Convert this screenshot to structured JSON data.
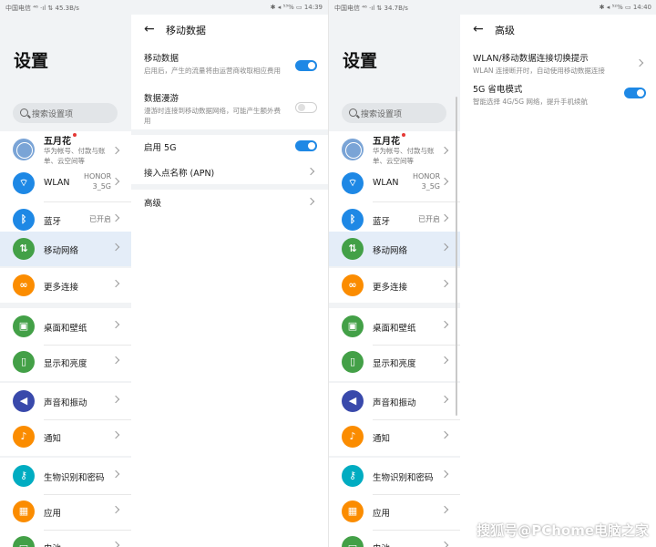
{
  "left_screen": {
    "status": {
      "left": "中国电信 ⁴⁶ ·ıl ⇅ 45.3B/s",
      "right": "✱ ◂ ⁵³% ▭ 14:39"
    },
    "settings": {
      "title": "设置",
      "search_placeholder": "搜索设置项",
      "account": {
        "name": "五月花",
        "desc": "华为帐号、付款与账单、云空间等"
      },
      "items": [
        {
          "label": "WLAN",
          "value": "HONOR 3_5G",
          "icon": "wifi-icon",
          "color": "#1e88e5"
        },
        {
          "label": "蓝牙",
          "value": "已开启",
          "icon": "bluetooth-icon",
          "color": "#1e88e5"
        },
        {
          "label": "移动网络",
          "value": "",
          "icon": "mobile-data-icon",
          "color": "#43a047"
        },
        {
          "label": "更多连接",
          "value": "",
          "icon": "link-icon",
          "color": "#fb8c00"
        },
        {
          "label": "桌面和壁纸",
          "value": "",
          "icon": "wallpaper-icon",
          "color": "#43a047"
        },
        {
          "label": "显示和亮度",
          "value": "",
          "icon": "display-icon",
          "color": "#43a047"
        },
        {
          "label": "声音和振动",
          "value": "",
          "icon": "sound-icon",
          "color": "#3949ab"
        },
        {
          "label": "通知",
          "value": "",
          "icon": "bell-icon",
          "color": "#fb8c00"
        },
        {
          "label": "生物识别和密码",
          "value": "",
          "icon": "key-icon",
          "color": "#00acc1"
        },
        {
          "label": "应用",
          "value": "",
          "icon": "apps-icon",
          "color": "#fb8c00"
        },
        {
          "label": "电池",
          "value": "",
          "icon": "battery-icon",
          "color": "#43a047"
        }
      ]
    },
    "detail": {
      "title": "移动数据",
      "items": [
        {
          "title": "移动数据",
          "desc": "启用后，产生的流量将由运营商收取相应费用",
          "control": "toggle-on"
        },
        {
          "title": "数据漫游",
          "desc": "漫游时连接到移动数据网络，可能产生额外费用",
          "control": "toggle-off"
        },
        {
          "title": "启用 5G",
          "desc": "",
          "control": "toggle-on"
        },
        {
          "title": "接入点名称 (APN)",
          "desc": "",
          "control": "chevron"
        },
        {
          "title": "高级",
          "desc": "",
          "control": "chevron"
        }
      ]
    }
  },
  "right_screen": {
    "status": {
      "left": "中国电信 ⁴⁶ ·ıl ⇅ 34.7B/s",
      "right": "✱ ◂ ⁵²% ▭ 14:40"
    },
    "settings": {
      "title": "设置",
      "search_placeholder": "搜索设置项",
      "account": {
        "name": "五月花",
        "desc": "华为帐号、付款与账单、云空间等"
      },
      "items": [
        {
          "label": "WLAN",
          "value": "HONOR 3_5G"
        },
        {
          "label": "蓝牙",
          "value": "已开启"
        },
        {
          "label": "移动网络",
          "value": ""
        },
        {
          "label": "更多连接",
          "value": ""
        },
        {
          "label": "桌面和壁纸",
          "value": ""
        },
        {
          "label": "显示和亮度",
          "value": ""
        },
        {
          "label": "声音和振动",
          "value": ""
        },
        {
          "label": "通知",
          "value": ""
        },
        {
          "label": "生物识别和密码",
          "value": ""
        },
        {
          "label": "应用",
          "value": ""
        },
        {
          "label": "电池",
          "value": ""
        }
      ]
    },
    "detail": {
      "title": "高级",
      "items": [
        {
          "title": "WLAN/移动数据连接切换提示",
          "desc": "WLAN 连接断开时，自动使用移动数据连接",
          "control": "chevron"
        },
        {
          "title": "5G 省电模式",
          "desc": "智能选择 4G/5G 网络，提升手机续航",
          "control": "toggle-on"
        }
      ]
    }
  },
  "watermark": "搜狐号@PChome电脑之家",
  "colors": {
    "accent": "#1e88e5",
    "active_row": "#e4edf8"
  }
}
